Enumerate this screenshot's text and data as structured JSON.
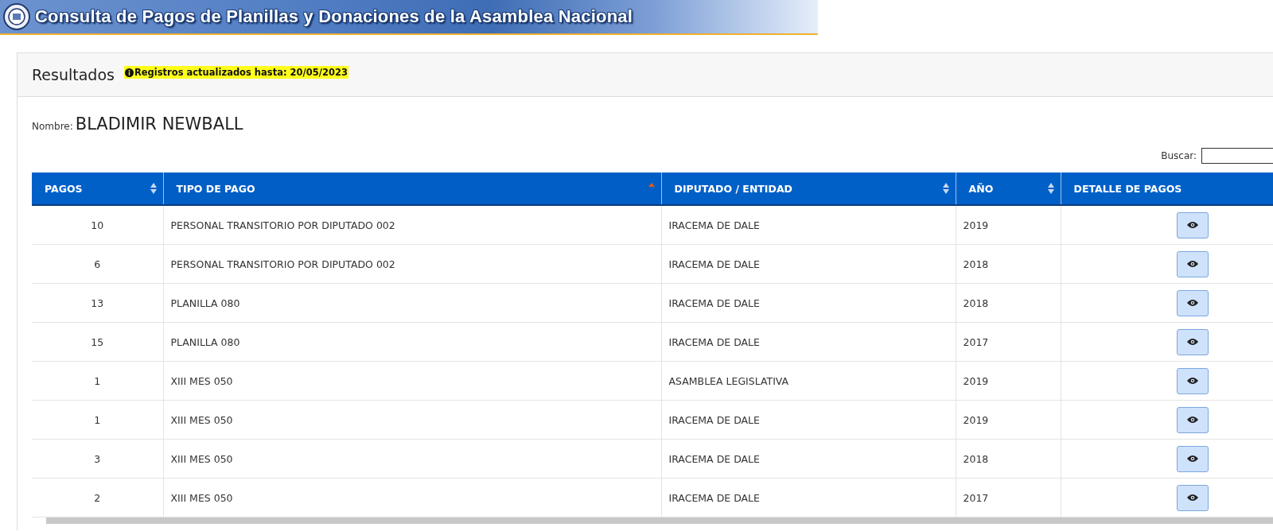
{
  "banner": {
    "title": "Consulta de Pagos de Planillas y Donaciones de la Asamblea Nacional"
  },
  "card": {
    "title": "Resultados",
    "notice": "Registros actualizados hasta: 20/05/2023"
  },
  "name": {
    "label": "Nombre:",
    "value": "BLADIMIR NEWBALL"
  },
  "search": {
    "label": "Buscar:"
  },
  "table": {
    "columns": [
      {
        "label": "PAGOS",
        "sortable": true,
        "sorted": false
      },
      {
        "label": "TIPO DE PAGO",
        "sortable": true,
        "sorted": true
      },
      {
        "label": "DIPUTADO / ENTIDAD",
        "sortable": true,
        "sorted": false
      },
      {
        "label": "AÑO",
        "sortable": true,
        "sorted": false
      },
      {
        "label": "DETALLE DE PAGOS",
        "sortable": false
      }
    ],
    "rows": [
      {
        "pagos": "10",
        "tipo": "PERSONAL TRANSITORIO POR DIPUTADO 002",
        "entidad": "IRACEMA DE DALE",
        "anio": "2019"
      },
      {
        "pagos": "6",
        "tipo": "PERSONAL TRANSITORIO POR DIPUTADO 002",
        "entidad": "IRACEMA DE DALE",
        "anio": "2018"
      },
      {
        "pagos": "13",
        "tipo": "PLANILLA 080",
        "entidad": "IRACEMA DE DALE",
        "anio": "2018"
      },
      {
        "pagos": "15",
        "tipo": "PLANILLA 080",
        "entidad": "IRACEMA DE DALE",
        "anio": "2017"
      },
      {
        "pagos": "1",
        "tipo": "XIII MES 050",
        "entidad": "ASAMBLEA LEGISLATIVA",
        "anio": "2019"
      },
      {
        "pagos": "1",
        "tipo": "XIII MES 050",
        "entidad": "IRACEMA DE DALE",
        "anio": "2019"
      },
      {
        "pagos": "3",
        "tipo": "XIII MES 050",
        "entidad": "IRACEMA DE DALE",
        "anio": "2018"
      },
      {
        "pagos": "2",
        "tipo": "XIII MES 050",
        "entidad": "IRACEMA DE DALE",
        "anio": "2017"
      }
    ]
  }
}
